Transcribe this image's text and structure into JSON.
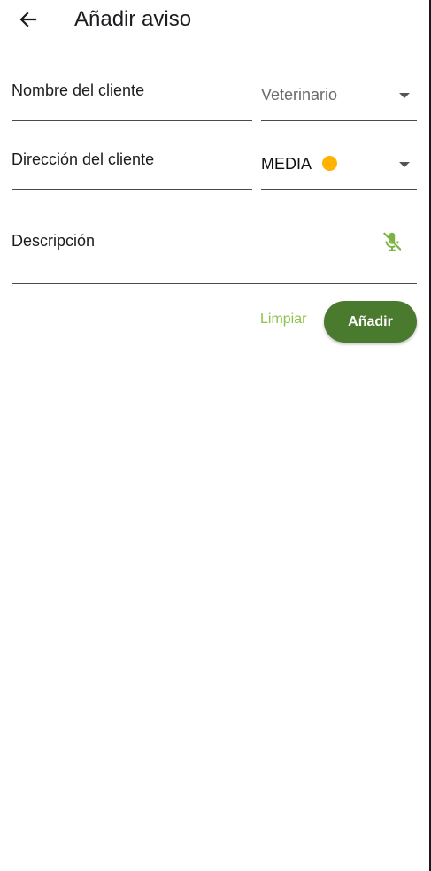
{
  "appbar": {
    "title": "Añadir aviso",
    "back_icon": "arrow-back-icon"
  },
  "form": {
    "client_name": {
      "label": "Nombre del cliente",
      "value": ""
    },
    "client_type": {
      "selected": "Veterinario"
    },
    "client_address": {
      "label": "Dirección del cliente",
      "value": ""
    },
    "priority": {
      "selected": "MEDIA",
      "indicator_color": "#FFB300"
    },
    "description": {
      "label": "Descripción",
      "value": "",
      "mic_icon": "mic-off-icon"
    }
  },
  "actions": {
    "clear_label": "Limpiar",
    "add_label": "Añadir"
  },
  "colors": {
    "accent": "#8BC34A",
    "primary_button": "#4A7A2E",
    "mic_icon": "#7CB342",
    "underline": "#4a4a4a"
  }
}
